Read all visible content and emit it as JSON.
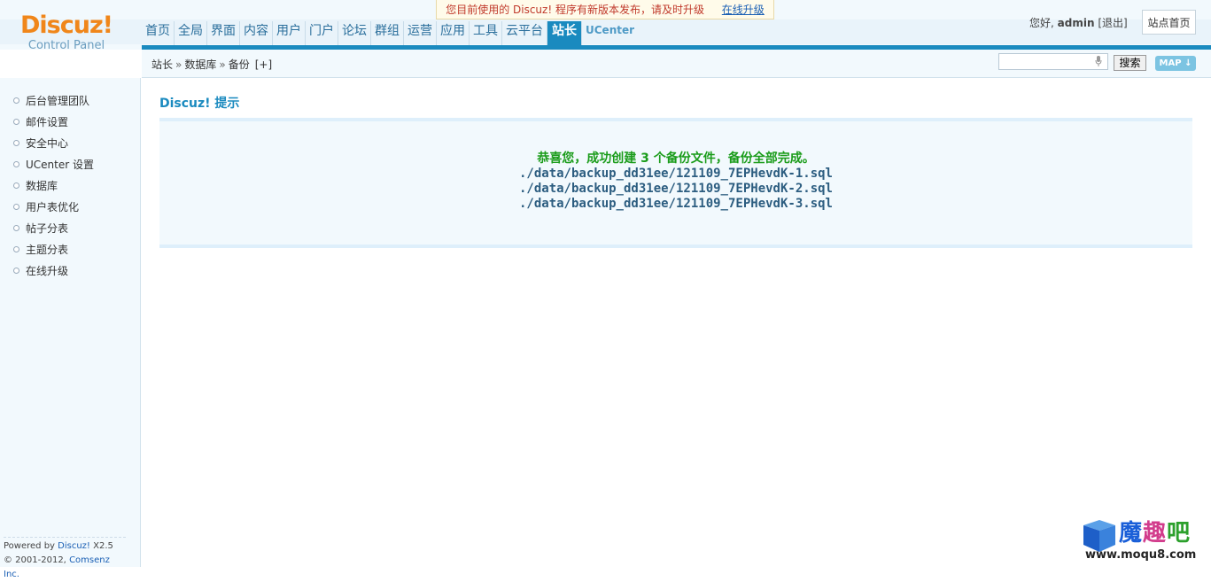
{
  "logo": {
    "name": "Discuz!",
    "subtitle": "Control Panel"
  },
  "nav": {
    "items": [
      "首页",
      "全局",
      "界面",
      "内容",
      "用户",
      "门户",
      "论坛",
      "群组",
      "运营",
      "应用",
      "工具",
      "云平台",
      "站长"
    ],
    "active": "站长",
    "ucenter": "UCenter"
  },
  "notice": {
    "text": "您目前使用的 Discuz! 程序有新版本发布，请及时升级",
    "link": "在线升级"
  },
  "user": {
    "greeting": "您好,",
    "name": "admin",
    "logout": "[退出]",
    "site_home": "站点首页"
  },
  "breadcrumb": {
    "items": [
      "站长",
      "数据库",
      "备份"
    ],
    "separator": "»",
    "add": "[+]"
  },
  "search": {
    "placeholder": "",
    "button": "搜索",
    "map_button": "MAP"
  },
  "sidebar": {
    "items": [
      "后台管理团队",
      "邮件设置",
      "安全中心",
      "UCenter 设置",
      "数据库",
      "用户表优化",
      "帖子分表",
      "主题分表",
      "在线升级"
    ]
  },
  "footer": {
    "powered_by": "Powered by",
    "product": "Discuz!",
    "version": "X2.5",
    "copyright": "© 2001-2012,",
    "company": "Comsenz Inc."
  },
  "main": {
    "title": "Discuz! 提示",
    "success": "恭喜您，成功创建 3 个备份文件，备份全部完成。",
    "files": [
      "./data/backup_dd31ee/121109_7EPHevdK-1.sql",
      "./data/backup_dd31ee/121109_7EPHevdK-2.sql",
      "./data/backup_dd31ee/121109_7EPHevdK-3.sql"
    ]
  },
  "watermark": {
    "text": "魔趣吧",
    "url": "www.moqu8.com",
    "sub": "MOQU8.COM"
  },
  "colors": {
    "accent": "#1a8abf",
    "logo": "#f0861a",
    "success": "#1a9c1a",
    "notice": "#c0392b"
  }
}
